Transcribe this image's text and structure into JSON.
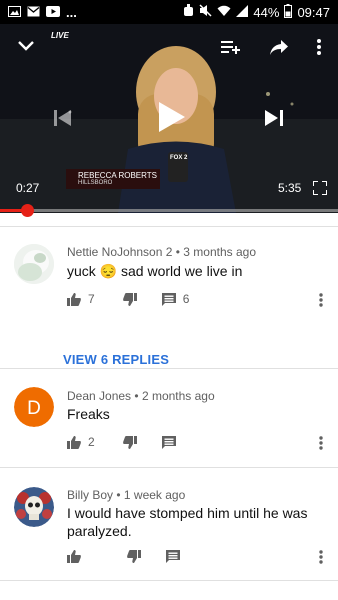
{
  "status_bar": {
    "battery_percent": "44%",
    "time": "09:47",
    "overflow": "..."
  },
  "player": {
    "live_badge": "LIVE",
    "lower_third_name": "REBECCA ROBERTS",
    "lower_third_place": "HILLSBORO",
    "mic_flag": "FOX 2",
    "elapsed": "0:27",
    "duration": "5:35",
    "progress_fraction": 0.08
  },
  "comments": [
    {
      "author": "Nettie NoJohnson 2",
      "age": "3 months ago",
      "text": "yuck 😔 sad world we live in",
      "likes": "7",
      "replies": "6",
      "avatar": "blurred-portrait"
    },
    {
      "author": "Dean Jones",
      "age": "2 months ago",
      "text": "Freaks",
      "likes": "2",
      "replies": "",
      "avatar_letter": "D",
      "avatar_color": "#ef6c00"
    },
    {
      "author": "Billy Boy",
      "age": "1 week ago",
      "text": "I would have stomped him until he was paralyzed.",
      "likes": "",
      "replies": "",
      "avatar": "skull-roses"
    }
  ],
  "view_replies_label": "VIEW 6 REPLIES",
  "separator": "•",
  "colors": {
    "accent_red": "#e62117",
    "link_blue": "#2b71d9",
    "icon_gray": "#606060"
  }
}
